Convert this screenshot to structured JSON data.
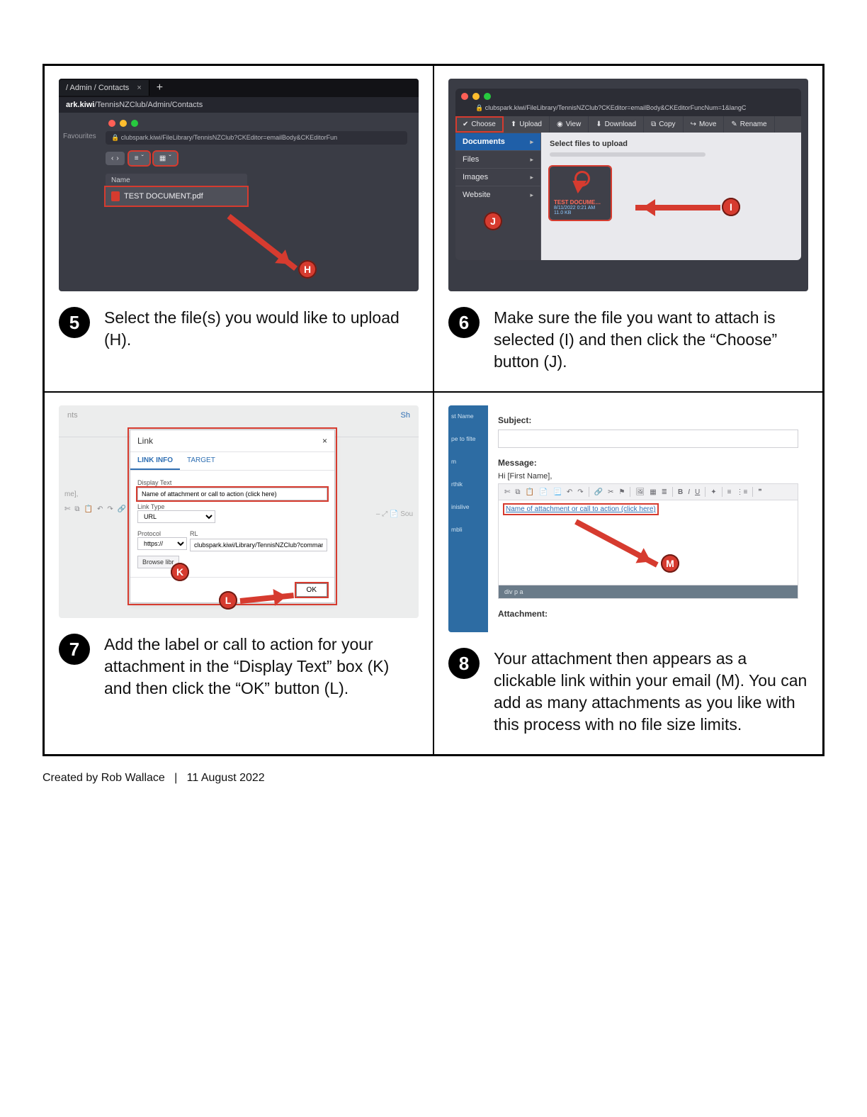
{
  "step5": {
    "number": "5",
    "instruction": "Select the file(s) you would like to upload (H).",
    "tab_label": "/ Admin / Contacts",
    "url_outer_prefix": "ark.kiwi",
    "url_outer_rest": "/TennisNZClub/Admin/Contacts",
    "favourites": "Favourites",
    "url_inner": "clubspark.kiwi/FileLibrary/TennisNZClub?CKEditor=emailBody&CKEditorFun",
    "col_name": "Name",
    "file_name": "TEST DOCUMENT.pdf",
    "marker": "H"
  },
  "step6": {
    "number": "6",
    "instruction": "Make sure the file you want to attach is selected (I) and then click the “Choose” button (J).",
    "url": "clubspark.kiwi/FileLibrary/TennisNZClub?CKEditor=emailBody&CKEditorFuncNum=1&langC",
    "toolbar": [
      "Choose",
      "Upload",
      "View",
      "Download",
      "Copy",
      "Move",
      "Rename"
    ],
    "categories": [
      "Documents",
      "Files",
      "Images",
      "Website"
    ],
    "select_label": "Select files to upload",
    "thumb_title": "TEST DOCUME…",
    "thumb_meta": "8/11/2022 0:21 AM\n11.0 KB",
    "marker_i": "I",
    "marker_j": "J"
  },
  "step7": {
    "number": "7",
    "instruction": "Add the label or call to action for your attachment in the “Display Text” box (K) and then click the “OK” button (L).",
    "top_left": "nts",
    "top_right": "Sh",
    "left_frag": "me],",
    "dialog_title": "Link",
    "tabs": [
      "LINK INFO",
      "TARGET"
    ],
    "display_text_label": "Display Text",
    "display_text_value": "Name of attachment or call to action (click here)",
    "link_type_label": "Link Type",
    "link_type_value": "URL",
    "protocol_label": "Protocol",
    "protocol_value": "https://",
    "url_label": "RL",
    "url_value": "clubspark.kiwi/Library/TennisNZClub?comman",
    "browse_label": "Browse libr",
    "ok_label": "OK",
    "ghost_right": "–   ⤢   📄 Sou",
    "marker_k": "K",
    "marker_l": "L"
  },
  "step8": {
    "number": "8",
    "instruction": "Your attachment then appears as a clickable link within your email (M). You can add as many attachments as you like with this process with no file size limits.",
    "side": [
      "st Name",
      "pe to filte",
      "m",
      "rthik",
      "inislive",
      "mbli"
    ],
    "subject_label": "Subject:",
    "message_label": "Message:",
    "greeting": "Hi [First Name],",
    "link_text": "Name of attachment or call to action (click here)",
    "statusbar": "div  p  a",
    "attachment_label": "Attachment:",
    "toolbar_letters": [
      "B",
      "I",
      "U"
    ],
    "marker_m": "M"
  },
  "footer": "Created by Rob Wallace   |   11 August 2022"
}
